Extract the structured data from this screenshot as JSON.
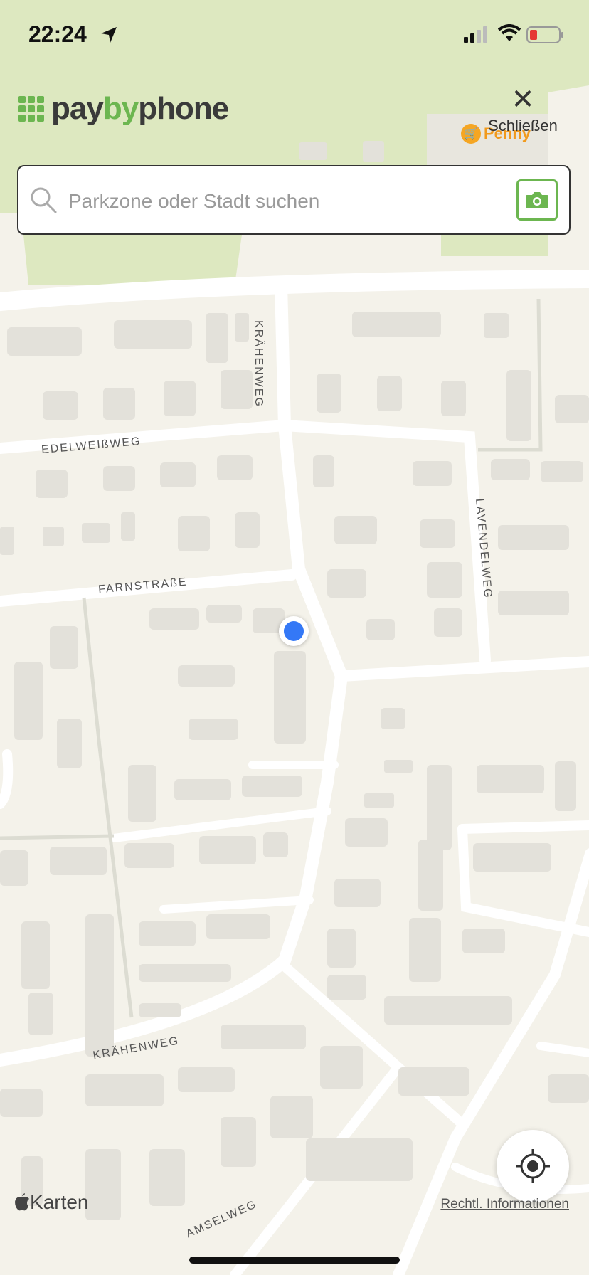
{
  "status_bar": {
    "time": "22:24"
  },
  "app": {
    "logo_pay": "pay",
    "logo_by": "by",
    "logo_phone": "phone"
  },
  "close": {
    "label": "Schließen"
  },
  "search": {
    "placeholder": "Parkzone oder Stadt suchen",
    "value": ""
  },
  "map": {
    "poi": "Penny",
    "streets": [
      "KRÄHENWEG",
      "EDELWEIßWEG",
      "FARNSTRAßE",
      "LAVENDELWEG",
      "KRÄHENWEG",
      "AMSELWEG"
    ],
    "attribution": "Karten",
    "legal": "Rechtl. Informationen"
  },
  "colors": {
    "brand_green": "#6cb650",
    "user_location": "#3478f6",
    "poi_orange": "#f5a623"
  },
  "icons": {
    "search": "search-icon",
    "camera": "camera-icon",
    "close": "close-icon",
    "locate": "locate-icon"
  }
}
